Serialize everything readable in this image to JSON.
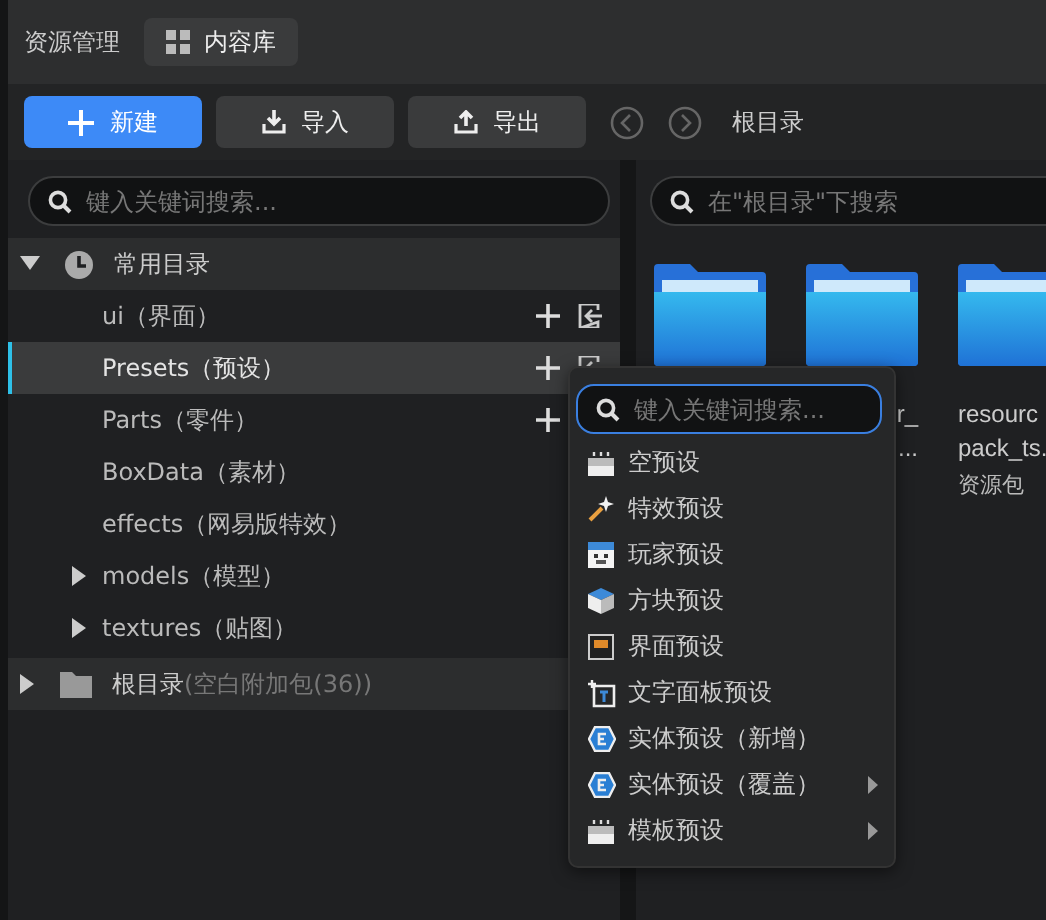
{
  "header": {
    "title": "资源管理",
    "tab": {
      "label": "内容库",
      "selected": true
    }
  },
  "toolbar": {
    "buttons": [
      {
        "kind": "new",
        "label": "新建"
      },
      {
        "kind": "import",
        "label": "导入"
      },
      {
        "kind": "export",
        "label": "导出"
      }
    ],
    "breadcrumb": "根目录"
  },
  "tree_search": {
    "placeholder": "键入关键词搜索..."
  },
  "tree": [
    {
      "kind": "recent",
      "label": "常用目录",
      "expanded": true,
      "children": [
        {
          "kind": "exportable",
          "label": "ui（界面）",
          "selected": false
        },
        {
          "kind": "exportable",
          "label": "Presets（预设）",
          "selected": true
        },
        {
          "kind": "addable",
          "label": "Parts（零件）",
          "selected": false
        },
        {
          "label": "BoxData（素材）",
          "selected": false
        },
        {
          "label": "effects（网易版特效）",
          "selected": false
        },
        {
          "label": "models（模型）",
          "selected": false,
          "expanded": false
        },
        {
          "label": "textures（贴图）",
          "selected": false,
          "expanded": false
        }
      ]
    },
    {
      "kind": "folder",
      "label": "根目录",
      "note": "(空白附加包(36))",
      "expanded": false
    }
  ],
  "content_search": {
    "placeholder": "在\"根目录\"下搜索"
  },
  "files": [
    {
      "kind": "folder"
    },
    {
      "kind": "folder",
      "lines": [
        "r_",
        "..."
      ]
    },
    {
      "kind": "folder",
      "lines": [
        "resourc",
        "pack_ts."
      ],
      "type": "资源包"
    }
  ],
  "menu": {
    "search": {
      "placeholder": "键入关键词搜索..."
    },
    "items": [
      {
        "kind": "empty",
        "label": "空预设",
        "submenu": false
      },
      {
        "kind": "effect",
        "label": "特效预设",
        "submenu": false
      },
      {
        "kind": "player",
        "label": "玩家预设",
        "submenu": false
      },
      {
        "kind": "block",
        "label": "方块预设",
        "submenu": false
      },
      {
        "kind": "ui",
        "label": "界面预设",
        "submenu": false
      },
      {
        "kind": "text",
        "label": "文字面板预设",
        "submenu": false
      },
      {
        "kind": "entity",
        "label": "实体预设（新增）",
        "submenu": false
      },
      {
        "kind": "entity",
        "label": "实体预设（覆盖）",
        "submenu": true
      },
      {
        "kind": "template",
        "label": "模板预设",
        "submenu": true
      }
    ]
  }
}
